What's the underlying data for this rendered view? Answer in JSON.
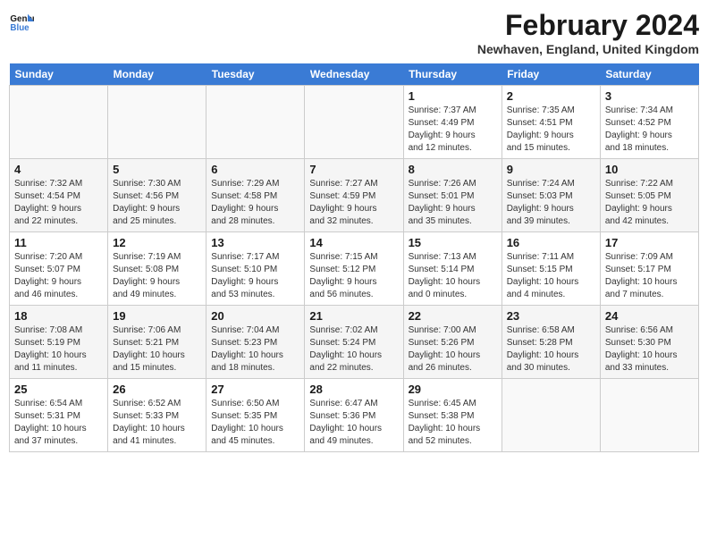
{
  "header": {
    "logo_line1": "General",
    "logo_line2": "Blue",
    "month_title": "February 2024",
    "location": "Newhaven, England, United Kingdom"
  },
  "calendar": {
    "days_of_week": [
      "Sunday",
      "Monday",
      "Tuesday",
      "Wednesday",
      "Thursday",
      "Friday",
      "Saturday"
    ],
    "weeks": [
      [
        {
          "day": "",
          "info": ""
        },
        {
          "day": "",
          "info": ""
        },
        {
          "day": "",
          "info": ""
        },
        {
          "day": "",
          "info": ""
        },
        {
          "day": "1",
          "info": "Sunrise: 7:37 AM\nSunset: 4:49 PM\nDaylight: 9 hours\nand 12 minutes."
        },
        {
          "day": "2",
          "info": "Sunrise: 7:35 AM\nSunset: 4:51 PM\nDaylight: 9 hours\nand 15 minutes."
        },
        {
          "day": "3",
          "info": "Sunrise: 7:34 AM\nSunset: 4:52 PM\nDaylight: 9 hours\nand 18 minutes."
        }
      ],
      [
        {
          "day": "4",
          "info": "Sunrise: 7:32 AM\nSunset: 4:54 PM\nDaylight: 9 hours\nand 22 minutes."
        },
        {
          "day": "5",
          "info": "Sunrise: 7:30 AM\nSunset: 4:56 PM\nDaylight: 9 hours\nand 25 minutes."
        },
        {
          "day": "6",
          "info": "Sunrise: 7:29 AM\nSunset: 4:58 PM\nDaylight: 9 hours\nand 28 minutes."
        },
        {
          "day": "7",
          "info": "Sunrise: 7:27 AM\nSunset: 4:59 PM\nDaylight: 9 hours\nand 32 minutes."
        },
        {
          "day": "8",
          "info": "Sunrise: 7:26 AM\nSunset: 5:01 PM\nDaylight: 9 hours\nand 35 minutes."
        },
        {
          "day": "9",
          "info": "Sunrise: 7:24 AM\nSunset: 5:03 PM\nDaylight: 9 hours\nand 39 minutes."
        },
        {
          "day": "10",
          "info": "Sunrise: 7:22 AM\nSunset: 5:05 PM\nDaylight: 9 hours\nand 42 minutes."
        }
      ],
      [
        {
          "day": "11",
          "info": "Sunrise: 7:20 AM\nSunset: 5:07 PM\nDaylight: 9 hours\nand 46 minutes."
        },
        {
          "day": "12",
          "info": "Sunrise: 7:19 AM\nSunset: 5:08 PM\nDaylight: 9 hours\nand 49 minutes."
        },
        {
          "day": "13",
          "info": "Sunrise: 7:17 AM\nSunset: 5:10 PM\nDaylight: 9 hours\nand 53 minutes."
        },
        {
          "day": "14",
          "info": "Sunrise: 7:15 AM\nSunset: 5:12 PM\nDaylight: 9 hours\nand 56 minutes."
        },
        {
          "day": "15",
          "info": "Sunrise: 7:13 AM\nSunset: 5:14 PM\nDaylight: 10 hours\nand 0 minutes."
        },
        {
          "day": "16",
          "info": "Sunrise: 7:11 AM\nSunset: 5:15 PM\nDaylight: 10 hours\nand 4 minutes."
        },
        {
          "day": "17",
          "info": "Sunrise: 7:09 AM\nSunset: 5:17 PM\nDaylight: 10 hours\nand 7 minutes."
        }
      ],
      [
        {
          "day": "18",
          "info": "Sunrise: 7:08 AM\nSunset: 5:19 PM\nDaylight: 10 hours\nand 11 minutes."
        },
        {
          "day": "19",
          "info": "Sunrise: 7:06 AM\nSunset: 5:21 PM\nDaylight: 10 hours\nand 15 minutes."
        },
        {
          "day": "20",
          "info": "Sunrise: 7:04 AM\nSunset: 5:23 PM\nDaylight: 10 hours\nand 18 minutes."
        },
        {
          "day": "21",
          "info": "Sunrise: 7:02 AM\nSunset: 5:24 PM\nDaylight: 10 hours\nand 22 minutes."
        },
        {
          "day": "22",
          "info": "Sunrise: 7:00 AM\nSunset: 5:26 PM\nDaylight: 10 hours\nand 26 minutes."
        },
        {
          "day": "23",
          "info": "Sunrise: 6:58 AM\nSunset: 5:28 PM\nDaylight: 10 hours\nand 30 minutes."
        },
        {
          "day": "24",
          "info": "Sunrise: 6:56 AM\nSunset: 5:30 PM\nDaylight: 10 hours\nand 33 minutes."
        }
      ],
      [
        {
          "day": "25",
          "info": "Sunrise: 6:54 AM\nSunset: 5:31 PM\nDaylight: 10 hours\nand 37 minutes."
        },
        {
          "day": "26",
          "info": "Sunrise: 6:52 AM\nSunset: 5:33 PM\nDaylight: 10 hours\nand 41 minutes."
        },
        {
          "day": "27",
          "info": "Sunrise: 6:50 AM\nSunset: 5:35 PM\nDaylight: 10 hours\nand 45 minutes."
        },
        {
          "day": "28",
          "info": "Sunrise: 6:47 AM\nSunset: 5:36 PM\nDaylight: 10 hours\nand 49 minutes."
        },
        {
          "day": "29",
          "info": "Sunrise: 6:45 AM\nSunset: 5:38 PM\nDaylight: 10 hours\nand 52 minutes."
        },
        {
          "day": "",
          "info": ""
        },
        {
          "day": "",
          "info": ""
        }
      ]
    ]
  }
}
